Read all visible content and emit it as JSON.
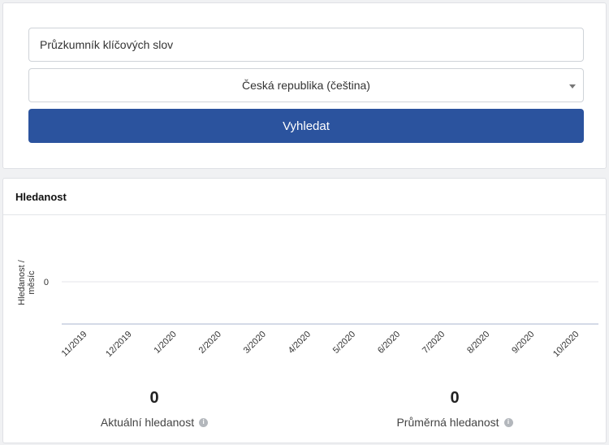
{
  "search": {
    "keyword_value": "Průzkumník klíčových slov",
    "region_selected": "Česká republika (čeština)",
    "submit_label": "Vyhledat"
  },
  "volume": {
    "title": "Hledanost",
    "current_value": "0",
    "current_label": "Aktuální hledanost",
    "average_value": "0",
    "average_label": "Průměrná hledanost",
    "info_icon": "info-icon"
  },
  "chart_data": {
    "type": "line",
    "ylabel": "Hledanost / měsíc",
    "y_ticks": [
      "0"
    ],
    "categories": [
      "11/2019",
      "12/2019",
      "1/2020",
      "2/2020",
      "3/2020",
      "4/2020",
      "5/2020",
      "6/2020",
      "7/2020",
      "8/2020",
      "9/2020",
      "10/2020"
    ],
    "series": [
      {
        "values": [
          0,
          0,
          0,
          0,
          0,
          0,
          0,
          0,
          0,
          0,
          0,
          0
        ]
      }
    ],
    "grid": true,
    "colors": {
      "baseline": "#aab4cf",
      "gridline": "#e5e6e8"
    }
  }
}
